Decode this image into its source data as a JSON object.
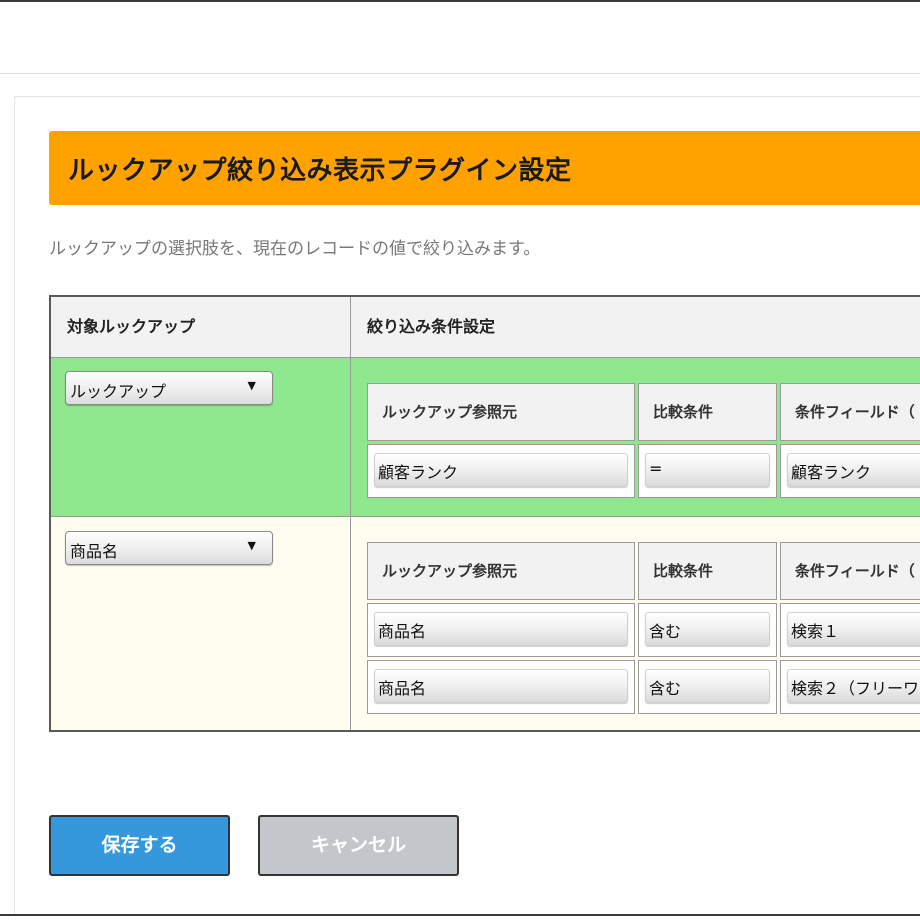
{
  "page": {
    "title": "ルックアップ絞り込み表示プラグイン設定",
    "description": "ルックアップの選択肢を、現在のレコードの値で絞り込みます。"
  },
  "main_table": {
    "headers": {
      "target_lookup": "対象ルックアップ",
      "filter_conditions": "絞り込み条件設定"
    },
    "rows": [
      {
        "lookup_select": "ルックアップ",
        "sub_headers": [
          "ルックアップ参照元",
          "比較条件",
          "条件フィールド（"
        ],
        "conditions": [
          {
            "source": "顧客ランク",
            "operator": "=",
            "field": "顧客ランク"
          }
        ]
      },
      {
        "lookup_select": "商品名",
        "sub_headers": [
          "ルックアップ参照元",
          "比較条件",
          "条件フィールド（"
        ],
        "conditions": [
          {
            "source": "商品名",
            "operator": "含む",
            "field": "検索１"
          },
          {
            "source": "商品名",
            "operator": "含む",
            "field": "検索２（フリーワ"
          }
        ]
      }
    ]
  },
  "buttons": {
    "save": "保存する",
    "cancel": "キャンセル"
  },
  "icons": {
    "dropdown": "chevron-down-icon"
  },
  "colors": {
    "title_bar": "#ffa200",
    "row_active": "#8fe88d",
    "row_alt": "#fffdf0",
    "save_button": "#3598dc",
    "cancel_button": "#c3c7cb"
  }
}
